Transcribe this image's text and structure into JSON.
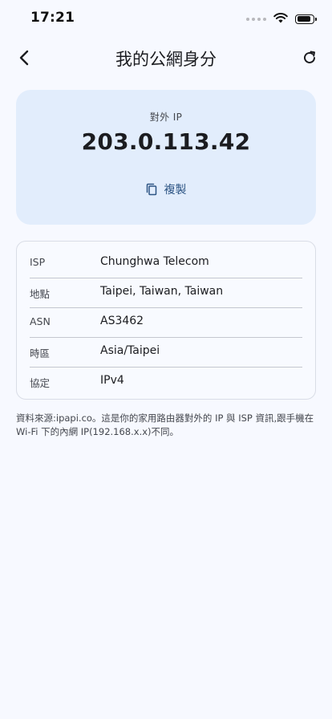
{
  "status_bar": {
    "time": "17:21"
  },
  "app_bar": {
    "title": "我的公網身分"
  },
  "ip_card": {
    "label": "對外 IP",
    "ip": "203.0.113.42",
    "copy_label": "複製"
  },
  "info": {
    "rows": [
      {
        "key": "ISP",
        "value": "Chunghwa Telecom"
      },
      {
        "key": "地點",
        "value": "Taipei, Taiwan, Taiwan"
      },
      {
        "key": "ASN",
        "value": "AS3462"
      },
      {
        "key": "時區",
        "value": "Asia/Taipei"
      },
      {
        "key": "協定",
        "value": "IPv4"
      }
    ]
  },
  "footnote": "資料來源:ipapi.co。這是你的家用路由器對外的 IP 與 ISP 資訊,跟手機在 Wi-Fi 下的內網 IP(192.168.x.x)不同。",
  "colors": {
    "background": "#f7f9ff",
    "ip_card_bg": "#e2edfc",
    "accent": "#2d5584"
  }
}
